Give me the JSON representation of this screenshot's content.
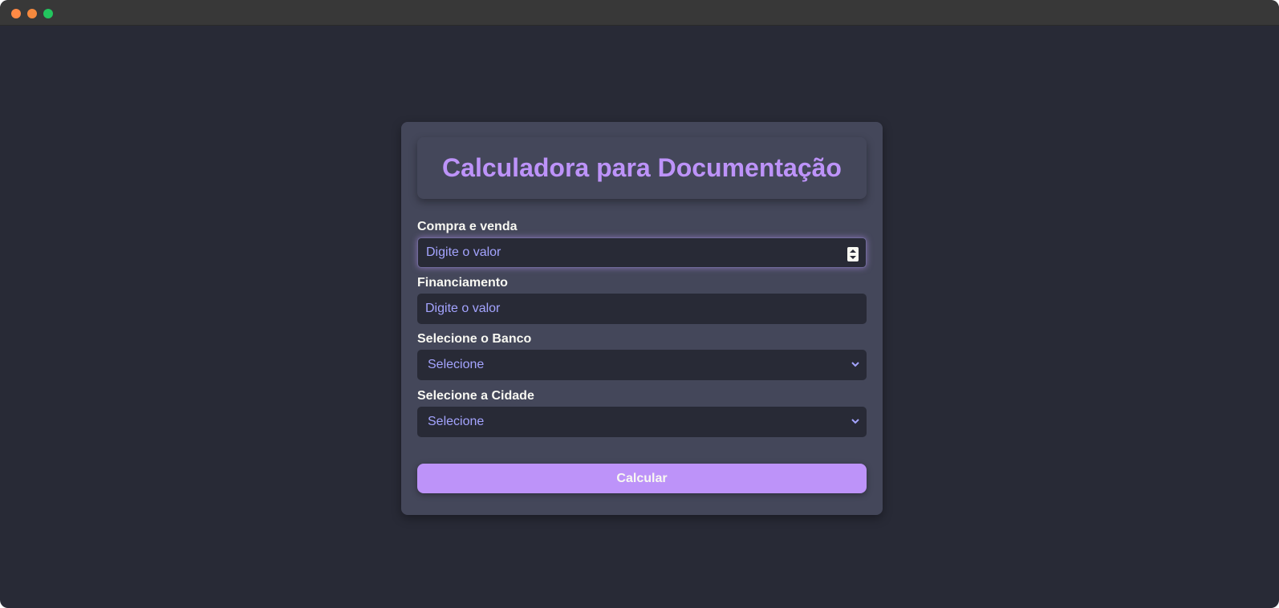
{
  "window": {
    "controls": [
      {
        "name": "close",
        "color": "#ff8a45"
      },
      {
        "name": "minimize",
        "color": "#f5893e"
      },
      {
        "name": "maximize",
        "color": "#22c55e"
      }
    ]
  },
  "colors": {
    "background": "#282a36",
    "card": "#44475a",
    "accent": "#bd93f9",
    "label": "#f8f8f2",
    "input_text": "#a4a4ff"
  },
  "form": {
    "title": "Calculadora para Documentação",
    "compra_venda": {
      "label": "Compra e venda",
      "placeholder": "Digite o valor"
    },
    "financiamento": {
      "label": "Financiamento",
      "placeholder": "Digite o valor"
    },
    "banco": {
      "label": "Selecione o Banco",
      "selected": "Selecione"
    },
    "cidade": {
      "label": "Selecione a Cidade",
      "selected": "Selecione"
    },
    "submit_label": "Calcular"
  }
}
